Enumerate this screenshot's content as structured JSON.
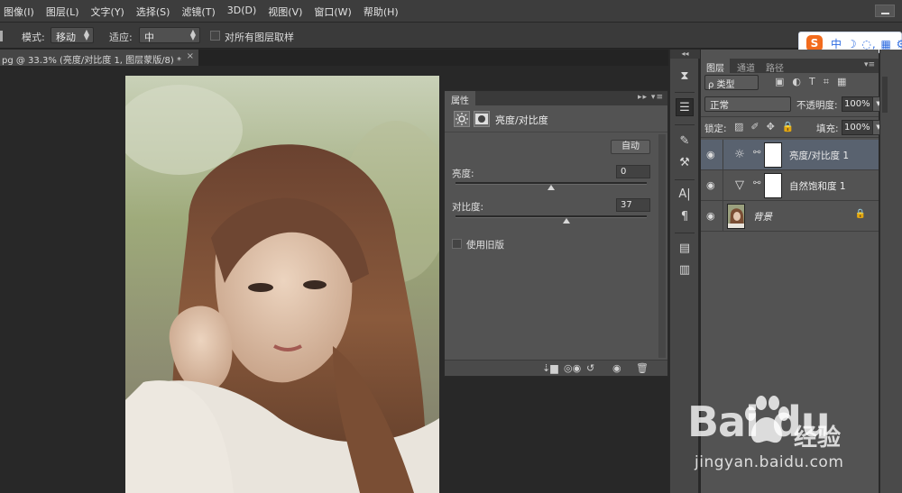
{
  "menu": [
    "图像(I)",
    "图层(L)",
    "文字(Y)",
    "选择(S)",
    "滤镜(T)",
    "3D(D)",
    "视图(V)",
    "窗口(W)",
    "帮助(H)"
  ],
  "options": {
    "mode_label": "模式:",
    "mode_value": "移动",
    "adapt_label": "适应:",
    "adapt_value": "中",
    "sample_all_label": "对所有图层取样"
  },
  "document_tab": {
    "title": "pg @ 33.3% (亮度/对比度 1, 图层蒙版/8) *",
    "close": "×"
  },
  "ime": {
    "logo": "S",
    "text": "中 ☽ ◌, ▦ ⚙"
  },
  "properties": {
    "tab": "属性",
    "title": "亮度/对比度",
    "auto_button": "自动",
    "brightness_label": "亮度:",
    "brightness_value": "0",
    "brightness_level": 0,
    "contrast_label": "对比度:",
    "contrast_value": "37",
    "contrast_level": 37,
    "legacy_label": "使用旧版"
  },
  "layers_panel": {
    "tabs": [
      "图层",
      "通道",
      "路径"
    ],
    "filter_value": "ρ 类型",
    "blend_value": "正常",
    "opacity_label": "不透明度:",
    "opacity_value": "100%",
    "lock_label": "锁定:",
    "fill_label": "填充:",
    "fill_value": "100%",
    "layers": [
      {
        "name": "亮度/对比度 1",
        "icon": "sun-adjustment-icon",
        "selected": true
      },
      {
        "name": "自然饱和度 1",
        "icon": "vibrance-triangle-icon",
        "selected": false
      },
      {
        "name": "背景",
        "icon": "photo-thumbnail",
        "selected": false
      }
    ]
  },
  "watermark": {
    "logo": "Bai  du",
    "cn": "经验",
    "url": "jingyan.baidu.com"
  }
}
